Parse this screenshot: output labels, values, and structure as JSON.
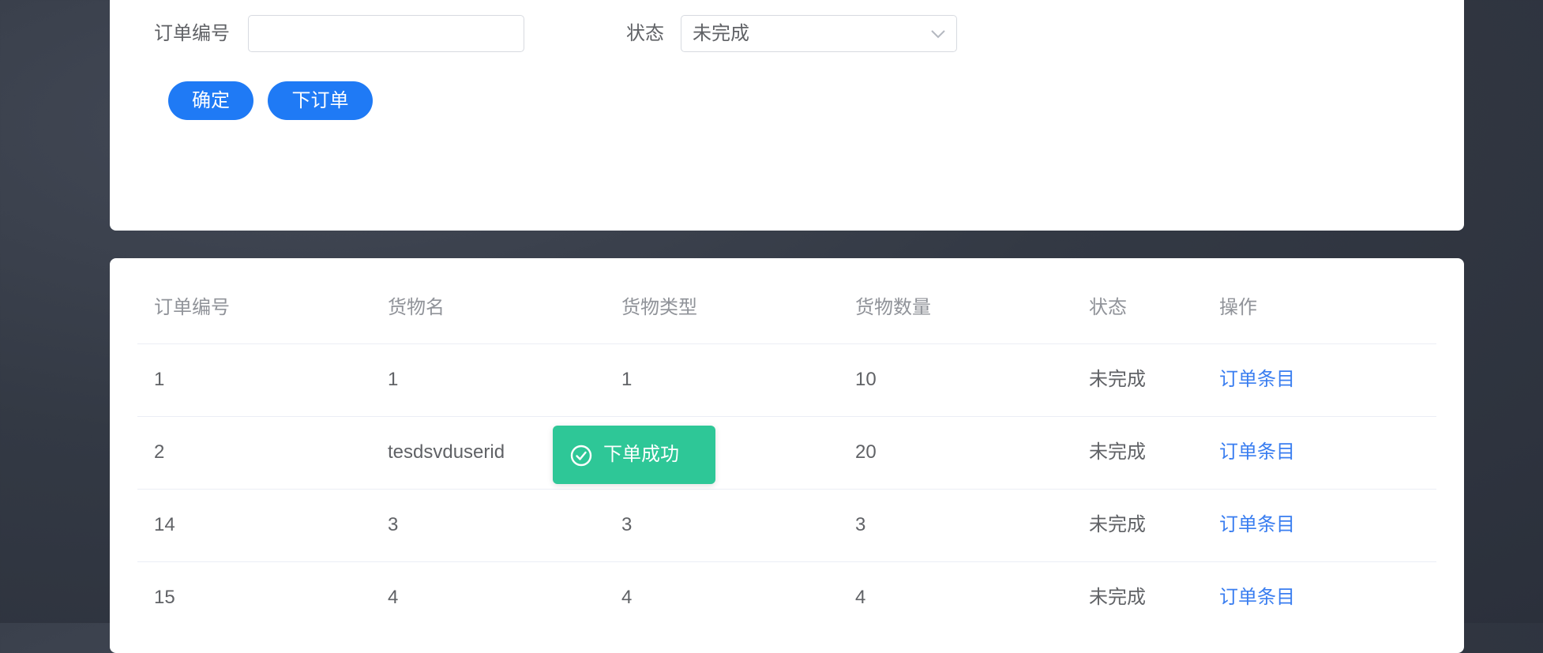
{
  "search": {
    "order_no_label": "订单编号",
    "order_no_value": "",
    "status_label": "状态",
    "status_selected": "未完成",
    "confirm_label": "确定",
    "place_order_label": "下订单"
  },
  "table": {
    "headers": [
      "订单编号",
      "货物名",
      "货物类型",
      "货物数量",
      "状态",
      "操作"
    ],
    "rows": [
      {
        "order_no": "1",
        "goods_name": "1",
        "goods_type": "1",
        "quantity": "10",
        "status": "未完成",
        "action": "订单条目"
      },
      {
        "order_no": "2",
        "goods_name": "tesdsvduserid",
        "goods_type": "",
        "quantity": "20",
        "status": "未完成",
        "action": "订单条目"
      },
      {
        "order_no": "14",
        "goods_name": "3",
        "goods_type": "3",
        "quantity": "3",
        "status": "未完成",
        "action": "订单条目"
      },
      {
        "order_no": "15",
        "goods_name": "4",
        "goods_type": "4",
        "quantity": "4",
        "status": "未完成",
        "action": "订单条目"
      }
    ]
  },
  "toast": {
    "message": "下单成功",
    "icon": "check-circle-icon"
  },
  "colors": {
    "primary": "#1f7af5",
    "link": "#3a7ef0",
    "success": "#2ec797",
    "background": "#333944"
  }
}
